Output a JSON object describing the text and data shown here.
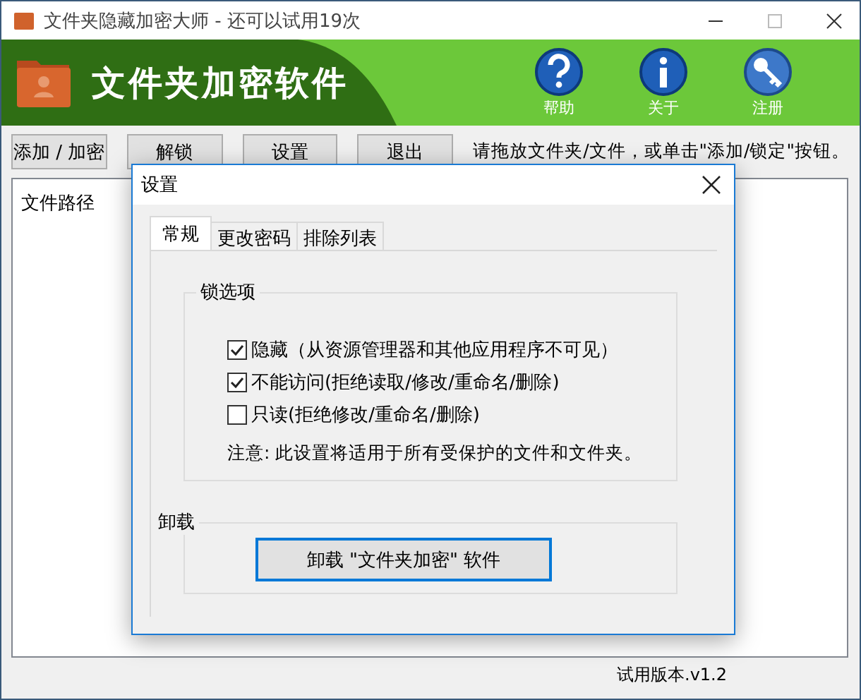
{
  "window": {
    "title": "文件夹隐藏加密大师 - 还可以试用19次"
  },
  "banner": {
    "title": "文件夹加密软件",
    "actions": [
      {
        "kind": "help",
        "label": "帮助"
      },
      {
        "kind": "info",
        "label": "关于"
      },
      {
        "kind": "key",
        "label": "注册"
      }
    ]
  },
  "toolbar": {
    "buttons": [
      "添加 / 加密",
      "解锁",
      "设置",
      "退出"
    ],
    "hint": "请拖放文件夹/文件，或单击\"添加/锁定\"按钮。"
  },
  "list": {
    "columns": [
      "文件路径"
    ]
  },
  "status_bar": "试用版本.v1.2",
  "dialog": {
    "title": "设置",
    "tabs": [
      {
        "label": "常规",
        "selected": true
      },
      {
        "label": "更改密码",
        "selected": false
      },
      {
        "label": "排除列表",
        "selected": false
      }
    ],
    "lock_group": {
      "title": "锁选项",
      "options": [
        {
          "label": "隐藏（从资源管理器和其他应用程序不可见）",
          "checked": true
        },
        {
          "label": "不能访问(拒绝读取/修改/重命名/删除)",
          "checked": true
        },
        {
          "label": "只读(拒绝修改/重命名/删除)",
          "checked": false
        }
      ],
      "note": "注意: 此设置将适用于所有受保护的文件和文件夹。"
    },
    "uninstall_group": {
      "title": "卸载",
      "button": "卸载 \"文件夹加密\" 软件"
    }
  }
}
